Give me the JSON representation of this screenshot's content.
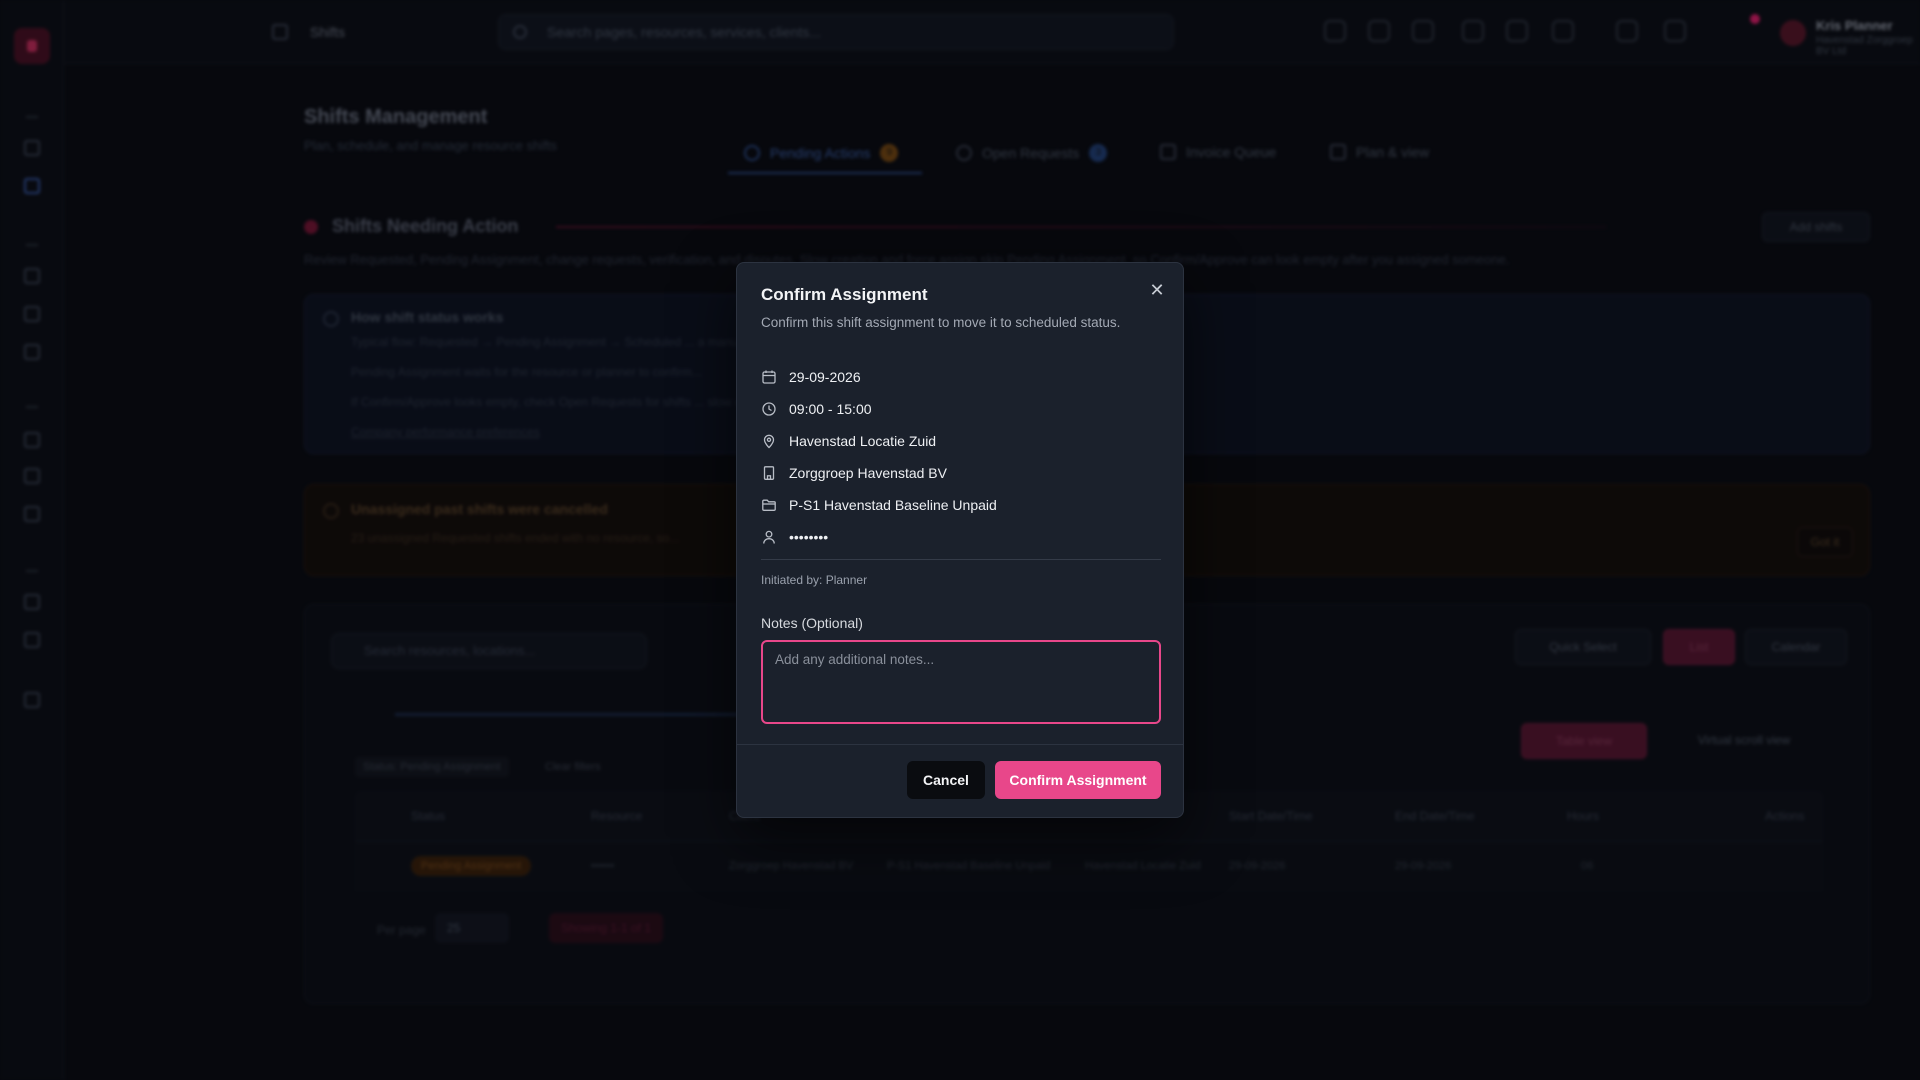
{
  "topbar": {
    "breadcrumb": "Shifts",
    "search_placeholder": "Search pages, resources, services, clients...",
    "user_name": "Kris Planner",
    "user_role": "Havenstad Zorggroep BV Ltd"
  },
  "page": {
    "title": "Shifts Management",
    "subtitle": "Plan, schedule, and manage resource shifts"
  },
  "tabs": [
    {
      "label": "Pending Actions",
      "count": "9",
      "count_color": "#7a4a10"
    },
    {
      "label": "Open Requests",
      "count": "3",
      "count_color": "#22427a"
    },
    {
      "label": "Invoice Queue"
    },
    {
      "label": "Plan & view"
    }
  ],
  "section": {
    "title": "Shifts Needing Action",
    "add_label": "Add shifts",
    "description": "Review Requested, Pending Assignment, change requests, verification, and disputes. Slow creation and force assign skip Pending Assignment, so Confirm/Approve can look empty after you assigned someone."
  },
  "info": {
    "title": "How shift status works",
    "lines": [
      "Typical flow: Requested → Pending Assignment → Scheduled ... a manual confirm is needed to finish the assignment and place the shift on Scheduled.",
      "Pending Assignment waits for the resource or planner to confirm...",
      "If Confirm/Approve looks empty, check Open Requests for shifts ... slow creation and force assign never land on Pending Assignment.",
      "Company performance preferences"
    ]
  },
  "warning": {
    "title": "Unassigned past shifts were cancelled",
    "line": "23 unassigned Requested shifts ended with no resource, so...",
    "button": "Got it"
  },
  "table": {
    "search_placeholder": "Search resources, locations...",
    "quick_select": "Quick Select",
    "list": "List",
    "calendar": "Calendar",
    "table_view": "Table view",
    "virtual_view": "Virtual scroll view",
    "count_text": "1 Shifts",
    "filter_chip": "Status: Pending Assignment",
    "clear": "Clear filters",
    "headers": [
      "Status",
      "Resource",
      "Client",
      "Start Date/Time",
      "End Date/Time",
      "Hours",
      "Actions"
    ],
    "row": {
      "status": "Pending Assignment",
      "resource": "••••••",
      "client": "Zorggroep Havenstad BV",
      "project": "P-S1 Havenstad Baseline Unpaid",
      "location": "Havenstad Locatie Zuid",
      "start": "29-09-2026",
      "end": "29-09-2026",
      "hours": "06"
    },
    "per_page_label": "Per page",
    "per_page": "25",
    "showing": "Showing 1-1 of 1"
  },
  "modal": {
    "title": "Confirm Assignment",
    "description": "Confirm this shift assignment to move it to scheduled status.",
    "details": {
      "date": "29-09-2026",
      "time": "09:00 - 15:00",
      "location": "Havenstad Locatie Zuid",
      "client": "Zorggroep Havenstad BV",
      "project": "P-S1 Havenstad Baseline Unpaid",
      "resource": "••••••••"
    },
    "initiated_by": "Initiated by: Planner",
    "notes_label": "Notes (Optional)",
    "notes_placeholder": "Add any additional notes...",
    "notes_value": "",
    "cancel_label": "Cancel",
    "confirm_label": "Confirm Assignment",
    "close_glyph": "✕"
  },
  "colors": {
    "accent": "#e8478a",
    "modal_bg": "#1b212c",
    "page_bg": "#090b10"
  }
}
